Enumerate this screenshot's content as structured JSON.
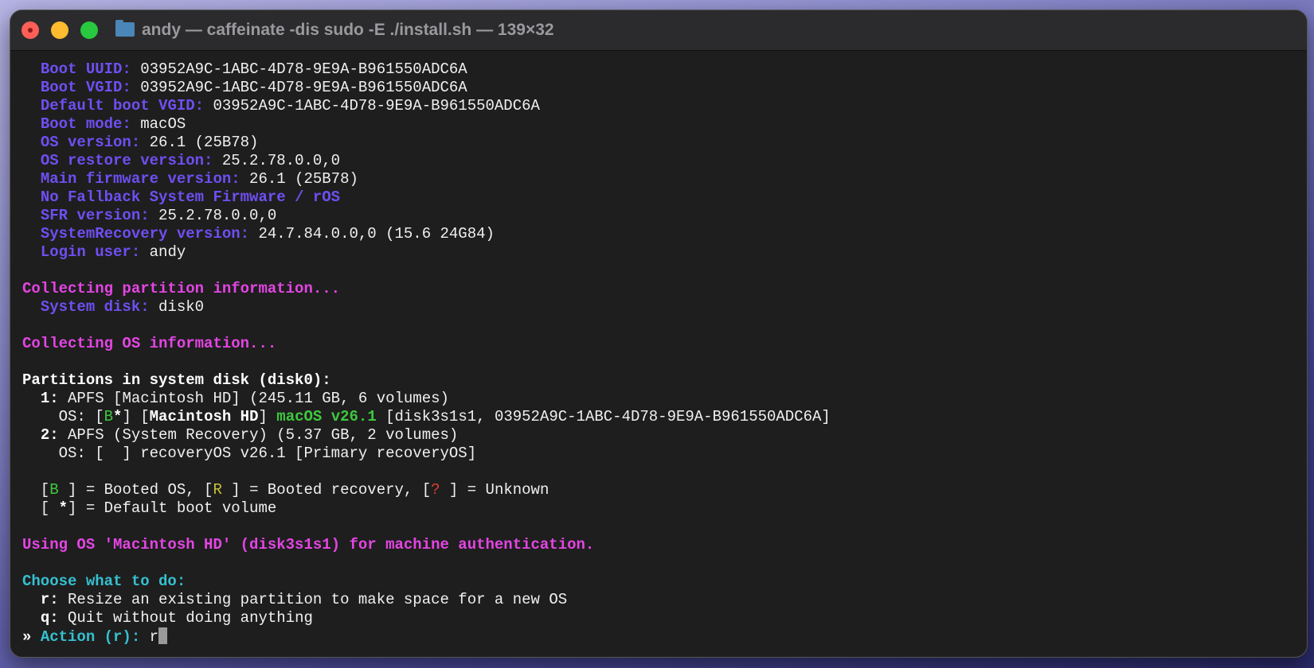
{
  "window": {
    "title": "andy — caffeinate -dis sudo -E ./install.sh — 139×32"
  },
  "terminal": {
    "lines": [
      [
        {
          "t": "  "
        },
        {
          "t": "Boot UUID:",
          "c": "lbl"
        },
        {
          "t": " 03952A9C-1ABC-4D78-9E9A-B961550ADC6A"
        }
      ],
      [
        {
          "t": "  "
        },
        {
          "t": "Boot VGID:",
          "c": "lbl"
        },
        {
          "t": " 03952A9C-1ABC-4D78-9E9A-B961550ADC6A"
        }
      ],
      [
        {
          "t": "  "
        },
        {
          "t": "Default boot VGID:",
          "c": "lbl"
        },
        {
          "t": " 03952A9C-1ABC-4D78-9E9A-B961550ADC6A"
        }
      ],
      [
        {
          "t": "  "
        },
        {
          "t": "Boot mode:",
          "c": "lbl"
        },
        {
          "t": " macOS"
        }
      ],
      [
        {
          "t": "  "
        },
        {
          "t": "OS version:",
          "c": "lbl"
        },
        {
          "t": " 26.1 (25B78)"
        }
      ],
      [
        {
          "t": "  "
        },
        {
          "t": "OS restore version:",
          "c": "lbl"
        },
        {
          "t": " 25.2.78.0.0,0"
        }
      ],
      [
        {
          "t": "  "
        },
        {
          "t": "Main firmware version:",
          "c": "lbl"
        },
        {
          "t": " 26.1 (25B78)"
        }
      ],
      [
        {
          "t": "  "
        },
        {
          "t": "No Fallback System Firmware / rOS",
          "c": "lbl"
        }
      ],
      [
        {
          "t": "  "
        },
        {
          "t": "SFR version:",
          "c": "lbl"
        },
        {
          "t": " 25.2.78.0.0,0"
        }
      ],
      [
        {
          "t": "  "
        },
        {
          "t": "SystemRecovery version:",
          "c": "lbl"
        },
        {
          "t": " 24.7.84.0.0,0 (15.6 24G84)"
        }
      ],
      [
        {
          "t": "  "
        },
        {
          "t": "Login user:",
          "c": "lbl"
        },
        {
          "t": " andy"
        }
      ],
      [],
      [
        {
          "t": "Collecting partition information...",
          "c": "mag"
        }
      ],
      [
        {
          "t": "  "
        },
        {
          "t": "System disk:",
          "c": "lbl"
        },
        {
          "t": " disk0"
        }
      ],
      [],
      [
        {
          "t": "Collecting OS information...",
          "c": "mag"
        }
      ],
      [],
      [
        {
          "t": "Partitions in system disk (disk0):",
          "c": "b"
        }
      ],
      [
        {
          "t": "  "
        },
        {
          "t": "1:",
          "c": "b"
        },
        {
          "t": " APFS [Macintosh HD] (245.11 GB, 6 volumes)"
        }
      ],
      [
        {
          "t": "    OS: ["
        },
        {
          "t": "B",
          "c": "grn"
        },
        {
          "t": "*",
          "c": "b"
        },
        {
          "t": "] ["
        },
        {
          "t": "Macintosh HD",
          "c": "b"
        },
        {
          "t": "] "
        },
        {
          "t": "macOS v26.1",
          "c": "grnb"
        },
        {
          "t": " [disk3s1s1, 03952A9C-1ABC-4D78-9E9A-B961550ADC6A]"
        }
      ],
      [
        {
          "t": "  "
        },
        {
          "t": "2:",
          "c": "b"
        },
        {
          "t": " APFS (System Recovery) (5.37 GB, 2 volumes)"
        }
      ],
      [
        {
          "t": "    OS: [  ] recoveryOS v26.1 [Primary recoveryOS]"
        }
      ],
      [],
      [
        {
          "t": "  ["
        },
        {
          "t": "B",
          "c": "grn"
        },
        {
          "t": " ] = Booted OS, ["
        },
        {
          "t": "R",
          "c": "yel"
        },
        {
          "t": " ] = Booted recovery, ["
        },
        {
          "t": "?",
          "c": "red"
        },
        {
          "t": " ] = Unknown"
        }
      ],
      [
        {
          "t": "  [ "
        },
        {
          "t": "*",
          "c": "b"
        },
        {
          "t": "] = Default boot volume"
        }
      ],
      [],
      [
        {
          "t": "Using OS 'Macintosh HD' (disk3s1s1) for machine authentication.",
          "c": "mag"
        }
      ],
      [],
      [
        {
          "t": "Choose what to do:",
          "c": "cyan"
        }
      ],
      [
        {
          "t": "  "
        },
        {
          "t": "r:",
          "c": "b"
        },
        {
          "t": " Resize an existing partition to make space for a new OS"
        }
      ],
      [
        {
          "t": "  "
        },
        {
          "t": "q:",
          "c": "b"
        },
        {
          "t": " Quit without doing anything"
        }
      ],
      [
        {
          "t": "» ",
          "c": "b"
        },
        {
          "t": "Action (r):",
          "c": "cyan"
        },
        {
          "t": " r"
        }
      ]
    ]
  }
}
